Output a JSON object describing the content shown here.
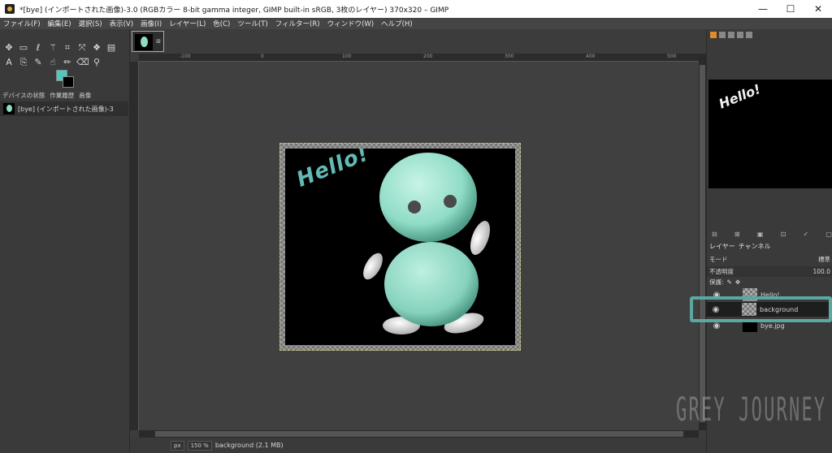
{
  "window": {
    "title": "*[bye] (インポートされた画像)-3.0 (RGBカラー 8-bit gamma integer, GIMP built-in sRGB, 3枚のレイヤー) 370x320 – GIMP",
    "minimize": "—",
    "maximize": "☐",
    "close": "✕"
  },
  "menu": [
    "ファイル(F)",
    "編集(E)",
    "選択(S)",
    "表示(V)",
    "画像(I)",
    "レイヤー(L)",
    "色(C)",
    "ツール(T)",
    "フィルター(R)",
    "ウィンドウ(W)",
    "ヘルプ(H)"
  ],
  "toolbox": {
    "tools": [
      "move-icon",
      "rect-select-icon",
      "free-select-icon",
      "fuzzy-select-icon",
      "crop-icon",
      "transform-icon",
      "warp-icon",
      "gradient-icon",
      "text-icon",
      "clone-icon",
      "path-icon",
      "smudge-icon",
      "paint-icon",
      "eraser-icon",
      "airbrush-icon",
      "eyedropper-icon",
      "zoom-icon"
    ],
    "fg_color": "#4fc8c0",
    "bg_color": "#000000"
  },
  "dock_left": {
    "tabs": [
      "デバイスの状態",
      "作業履歴",
      "画像"
    ],
    "image_item": "[bye] (インポートされた画像)-3"
  },
  "canvas": {
    "ruler_numbers": [
      "-100",
      "0",
      "100",
      "200",
      "300",
      "400",
      "500"
    ],
    "hello_text": "Hello!"
  },
  "statusbar": {
    "unit": "px",
    "zoom": "150 %",
    "info": "background (2.1 MB)"
  },
  "right_dock": {
    "preview_text": "Hello!",
    "tabs": [
      "レイヤー",
      "チャンネル"
    ],
    "mode_label": "モード",
    "mode_value": "標準",
    "opacity_label": "不透明度",
    "opacity_value": "100.0",
    "lock_label": "保護:",
    "layers": [
      {
        "name": "Hello!",
        "selected": false
      },
      {
        "name": "background",
        "selected": true
      },
      {
        "name": "bye.jpg",
        "selected": false
      }
    ]
  },
  "watermark": "GREY JOURNEY",
  "colors": {
    "highlight": "#5aa8a0",
    "canvas_bg": "#404040",
    "character": "#8fdcc6"
  }
}
